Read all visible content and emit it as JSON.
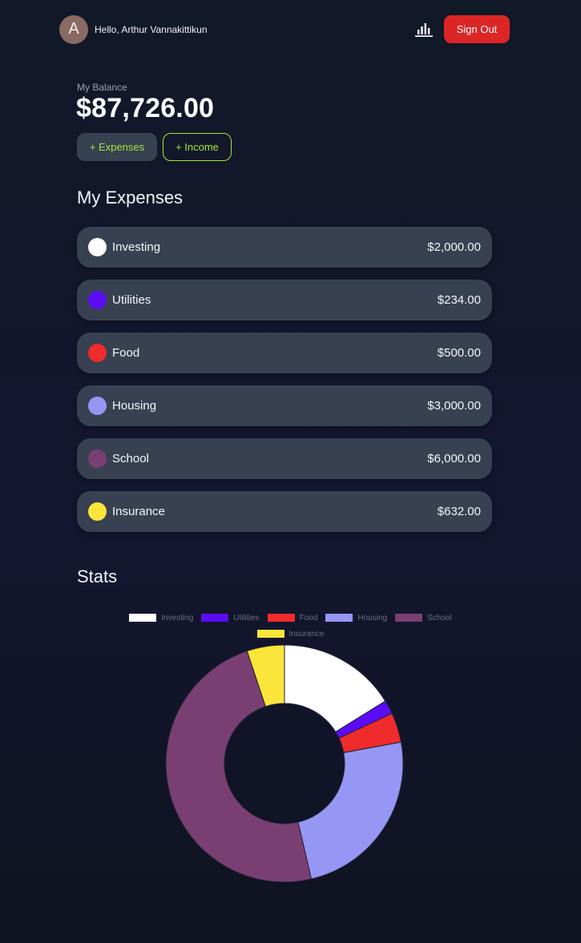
{
  "header": {
    "avatar_letter": "A",
    "greeting": "Hello, Arthur Vannakittikun",
    "stats_icon": "bar-chart-icon",
    "signout_label": "Sign Out"
  },
  "balance": {
    "label": "My Balance",
    "value": "$87,726.00",
    "add_expenses_label": "+ Expenses",
    "add_income_label": "+ Income"
  },
  "expenses": {
    "title": "My Expenses",
    "items": [
      {
        "name": "Investing",
        "amount": "$2,000.00",
        "color": "#ffffff"
      },
      {
        "name": "Utilities",
        "amount": "$234.00",
        "color": "#5b0cf5"
      },
      {
        "name": "Food",
        "amount": "$500.00",
        "color": "#ef2b2b"
      },
      {
        "name": "Housing",
        "amount": "$3,000.00",
        "color": "#9696f5"
      },
      {
        "name": "School",
        "amount": "$6,000.00",
        "color": "#7a3f72"
      },
      {
        "name": "Insurance",
        "amount": "$632.00",
        "color": "#fbe53b"
      }
    ]
  },
  "stats": {
    "title": "Stats"
  },
  "chart_data": {
    "type": "pie",
    "labels": [
      "Investing",
      "Utilities",
      "Food",
      "Housing",
      "School",
      "Insurance"
    ],
    "values": [
      2000,
      234,
      500,
      3000,
      6000,
      632
    ],
    "colors": [
      "#ffffff",
      "#5b0cf5",
      "#ef2b2b",
      "#9696f5",
      "#7a3f72",
      "#fbe53b"
    ],
    "legend_position": "top",
    "donut": true
  }
}
